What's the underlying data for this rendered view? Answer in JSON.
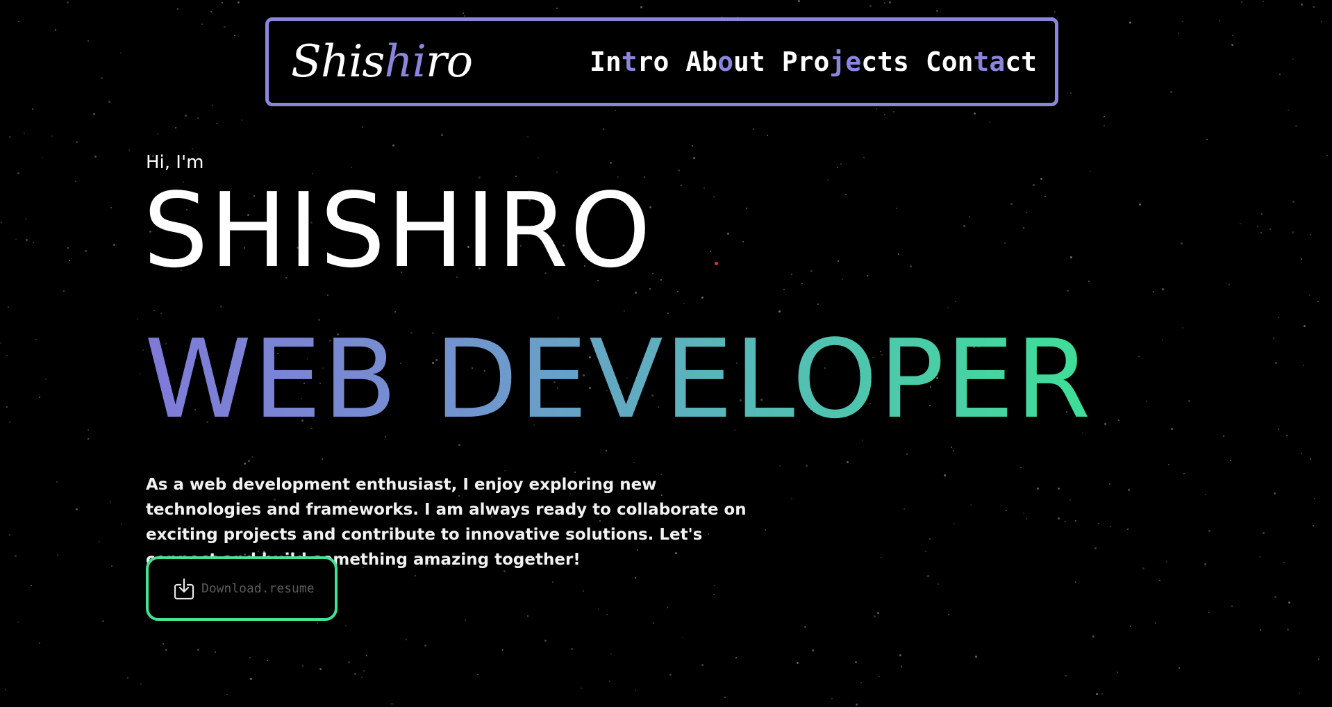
{
  "brand": {
    "logo_start": "Shis",
    "logo_accent": "hi",
    "logo_end": "ro"
  },
  "nav": {
    "items": [
      {
        "start": "In",
        "accent": "t",
        "end": "ro"
      },
      {
        "start": "Ab",
        "accent": "o",
        "end": "ut"
      },
      {
        "start": "Pro",
        "accent": "je",
        "end": "cts"
      },
      {
        "start": "Con",
        "accent": "ta",
        "end": "ct"
      }
    ]
  },
  "hero": {
    "greeting": "Hi, I'm",
    "name": "SHISHIRO",
    "role": "WEB DEVELOPER",
    "description": "As a web development enthusiast, I enjoy exploring new technologies and frameworks. I am always ready to collaborate on exciting projects and contribute to innovative solutions. Let's connect and build something amazing together!",
    "button_label": "Download.resume",
    "button_icon": "download-icon"
  },
  "colors": {
    "accent_purple": "#8a86dc",
    "accent_green": "#41e394",
    "background": "#000000"
  }
}
